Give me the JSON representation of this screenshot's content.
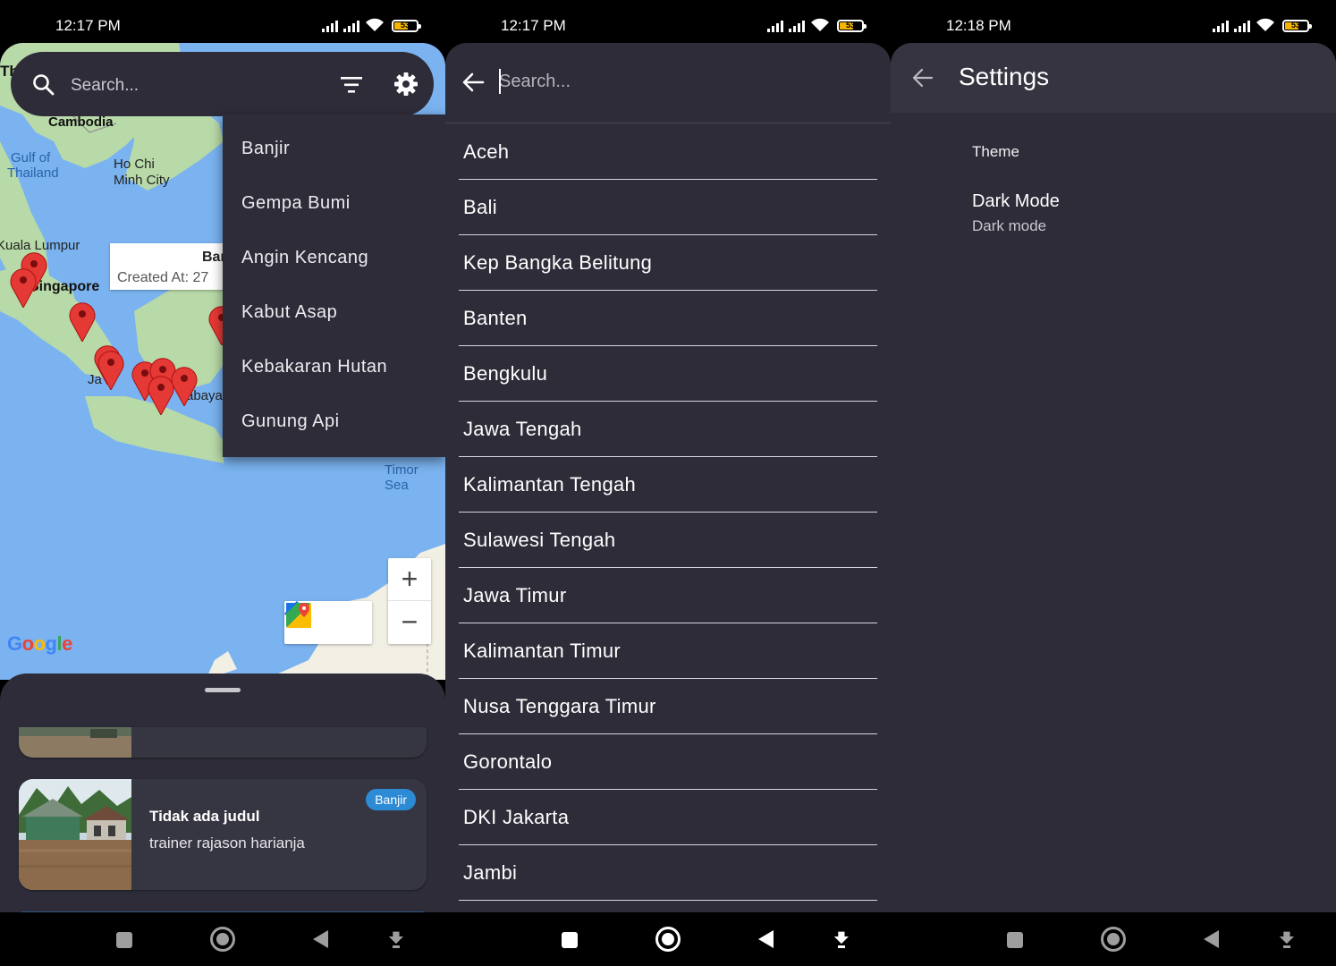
{
  "status": [
    {
      "time": "12:17 PM",
      "battery": "53"
    },
    {
      "time": "12:17 PM",
      "battery": "53"
    },
    {
      "time": "12:18 PM",
      "battery": "53"
    }
  ],
  "map_screen": {
    "search_placeholder": "Search...",
    "map_labels": {
      "thailand_partial": "Th",
      "cambodia": "Cambodia",
      "gulf": "Gulf of",
      "gulf2": "Thailand",
      "hcmc1": "Ho Chi",
      "hcmc2": "Minh City",
      "kuala_lumpur": "Kuala Lumpur",
      "singapore": "Singapore",
      "jakarta_partial": "Ja",
      "surabaya_partial": "abaya",
      "timor_sea": "Timor Sea",
      "google": "Google"
    },
    "filter_menu": [
      "Banjir",
      "Gempa Bumi",
      "Angin Kencang",
      "Kabut Asap",
      "Kebakaran Hutan",
      "Gunung Api"
    ],
    "info_window": {
      "title": "Bar",
      "subtitle": "Created At: 27"
    },
    "zoom_in": "+",
    "zoom_out": "−",
    "card": {
      "title": "Tidak ada judul",
      "description": "trainer rajason harianja",
      "badge": "Banjir"
    }
  },
  "search_screen": {
    "placeholder": "Search...",
    "provinces": [
      "Aceh",
      "Bali",
      "Kep Bangka Belitung",
      "Banten",
      "Bengkulu",
      "Jawa Tengah",
      "Kalimantan Tengah",
      "Sulawesi Tengah",
      "Jawa Timur",
      "Kalimantan Timur",
      "Nusa Tenggara Timur",
      "Gorontalo",
      "DKI Jakarta",
      "Jambi"
    ]
  },
  "settings_screen": {
    "title": "Settings",
    "section": "Theme",
    "dark_mode_title": "Dark Mode",
    "dark_mode_subtitle": "Dark mode"
  },
  "colors": {
    "surface": "#2d2c38",
    "water": "#7ab3f0",
    "land": "#b8d9a8",
    "pin": "#e53935",
    "badge": "#2d8bd6"
  }
}
